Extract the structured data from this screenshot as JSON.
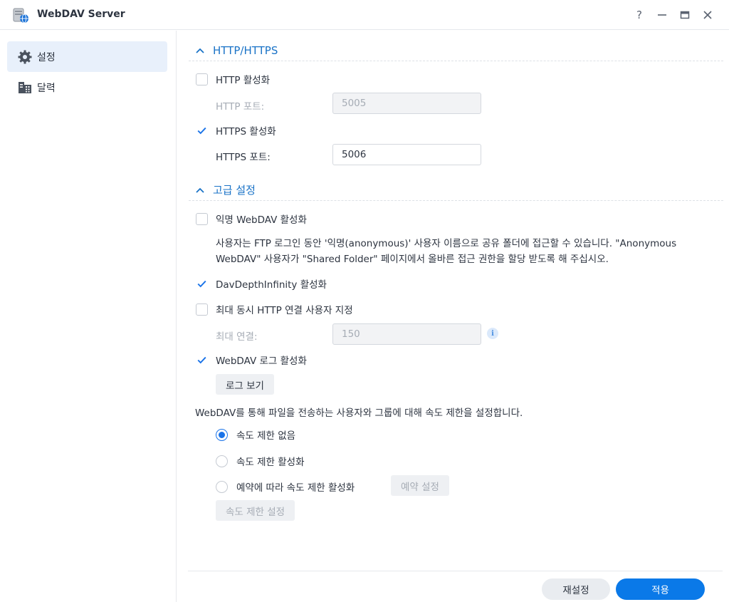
{
  "window": {
    "title": "WebDAV Server",
    "controls": {
      "help": "?",
      "minimize": "—",
      "maximize": "▭",
      "close": "✕"
    }
  },
  "sidebar": {
    "items": [
      {
        "label": "설정",
        "icon": "gear-icon",
        "active": true
      },
      {
        "label": "달력",
        "icon": "calendar-icon",
        "active": false
      }
    ]
  },
  "http_section": {
    "title": "HTTP/HTTPS",
    "http_enable": {
      "label": "HTTP 활성화",
      "checked": false
    },
    "http_port": {
      "label": "HTTP 포트:",
      "value": "5005"
    },
    "https_enable": {
      "label": "HTTPS 활성화",
      "checked": true
    },
    "https_port": {
      "label": "HTTPS 포트:",
      "value": "5006"
    }
  },
  "advanced_section": {
    "title": "고급 설정",
    "anonymous": {
      "label": "익명 WebDAV 활성화",
      "checked": false
    },
    "anonymous_desc_1": "사용자는 FTP 로그인 동안 '익명(anonymous)' 사용자 이름으로 공유 폴더에 접근할 수 있습니다. \"Anonymous",
    "anonymous_desc_2": "WebDAV\" 사용자가 \"Shared Folder\" 페이지에서 올바른 접근 권한을 할당 받도록 해 주십시오.",
    "depth_infinity": {
      "label": "DavDepthInfinity 활성화",
      "checked": true
    },
    "max_http": {
      "label": "최대 동시 HTTP 연결 사용자 지정",
      "checked": false
    },
    "max_conn": {
      "label": "최대 연결:",
      "value": "150"
    },
    "log_enable": {
      "label": "WebDAV 로그 활성화",
      "checked": true
    },
    "view_log_button": "로그 보기",
    "speed_desc": "WebDAV를 통해 파일을 전송하는 사용자와 그룹에 대해 속도 제한을 설정합니다.",
    "speed_options": [
      {
        "label": "속도 제한 없음",
        "selected": true
      },
      {
        "label": "속도 제한 활성화",
        "selected": false
      },
      {
        "label": "예약에 따라 속도 제한 활성화",
        "selected": false
      }
    ],
    "schedule_button": "예약 설정",
    "speed_settings_button": "속도 제한 설정"
  },
  "footer": {
    "reset_button": "재설정",
    "apply_button": "적용"
  },
  "colors": {
    "accent": "#1a73e8",
    "section_title": "#1a73c7",
    "sidebar_active": "#e8f0fb",
    "apply_button": "#0a79e8"
  }
}
